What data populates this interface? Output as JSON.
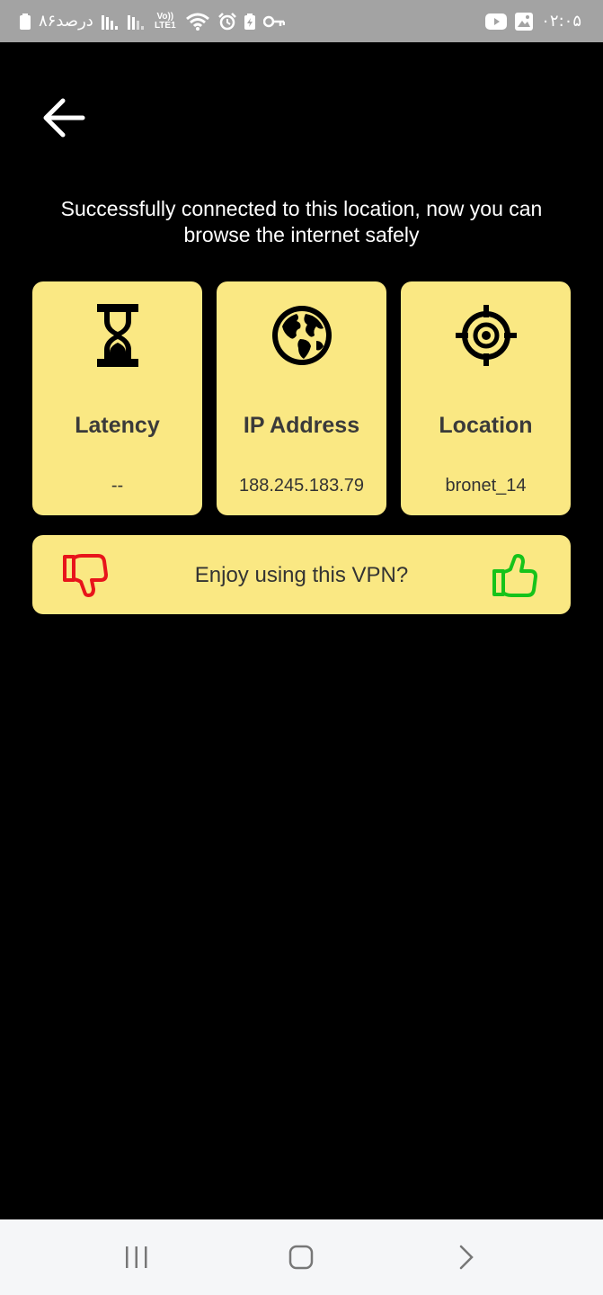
{
  "status_bar": {
    "battery_percent_text": "۸۶درصد",
    "network_type": "Vo)) LTE1",
    "time": "۰۲:۰۵",
    "icons": [
      "battery-icon",
      "signal-icon",
      "signal-icon",
      "volte-lte-icon",
      "wifi-icon",
      "alarm-icon",
      "battery-saver-icon",
      "vpn-key-icon",
      "youtube-icon",
      "gallery-icon"
    ]
  },
  "header": {
    "back_icon": "arrow-left-icon"
  },
  "message": "Successfully connected to this location, now you can browse the internet safely",
  "cards": [
    {
      "icon": "hourglass-icon",
      "title": "Latency",
      "value": "--"
    },
    {
      "icon": "globe-icon",
      "title": "IP Address",
      "value": "188.245.183.79"
    },
    {
      "icon": "crosshair-icon",
      "title": "Location",
      "value": "bronet_14"
    }
  ],
  "feedback": {
    "question": "Enjoy using this VPN?",
    "dislike_icon": "thumbs-down-icon",
    "like_icon": "thumbs-up-icon"
  },
  "nav_bar": {
    "items": [
      "recents-icon",
      "home-icon",
      "back-chevron-icon"
    ]
  },
  "colors": {
    "background": "#000000",
    "card": "#fae883",
    "dislike": "#e8141b",
    "like": "#16c31a",
    "status_bar": "#a3a3a3"
  }
}
